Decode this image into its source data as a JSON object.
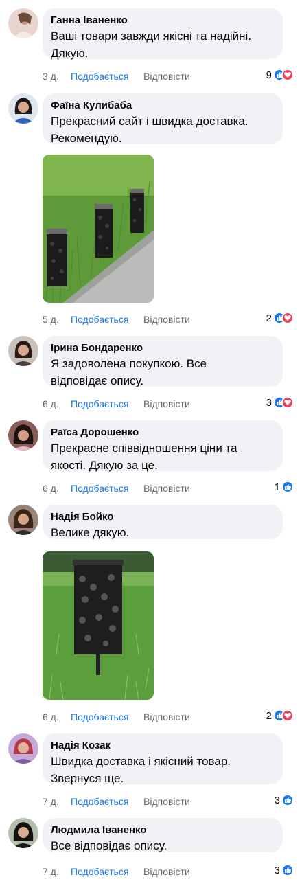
{
  "comments": [
    {
      "author": "Ганна Іваненко",
      "text": "Ваші товари завжди якісні та надійні.\nДякую.",
      "time": "3 д.",
      "like": "Подобається",
      "reply": "Відповісти",
      "count": "9"
    },
    {
      "author": "Фаїна Кулибаба",
      "text": "Прекрасний сайт і швидка доставка.\nРекомендую.",
      "time": "5 д.",
      "like": "Подобається",
      "reply": "Відповісти",
      "count": "2"
    },
    {
      "author": "Ірина Бондаренко",
      "text": "Я задоволена покупкою. Все\nвідповідає опису.",
      "time": "6 д.",
      "like": "Подобається",
      "reply": "Відповісти",
      "count": "3"
    },
    {
      "author": "Раїса Дорошенко",
      "text": "Прекрасне співвідношення ціни та\nякості. Дякую за це.",
      "time": "6 д.",
      "like": "Подобається",
      "reply": "Відповісти",
      "count": "1"
    },
    {
      "author": "Надія Бойко",
      "text": "Велике дякую.",
      "time": "6 д.",
      "like": "Подобається",
      "reply": "Відповісти",
      "count": "2"
    },
    {
      "author": "Надія Козак",
      "text": "Швидка доставка і якісний товар.\nЗвернуся ще.",
      "time": "7 д.",
      "like": "Подобається",
      "reply": "Відповісти",
      "count": "3"
    },
    {
      "author": "Людмила Іваненко",
      "text": "Все відповідає опису.",
      "time": "7 д.",
      "like": "Подобається",
      "reply": "Відповісти",
      "count": "3"
    }
  ],
  "colors": {
    "bubble": "#f0f2f5",
    "link": "#1877f2",
    "meta": "#65676b",
    "like_react": "#1877f2",
    "love_react": "#f33e58"
  },
  "icons": {
    "like": "thumbs-up-icon",
    "love": "heart-icon"
  }
}
